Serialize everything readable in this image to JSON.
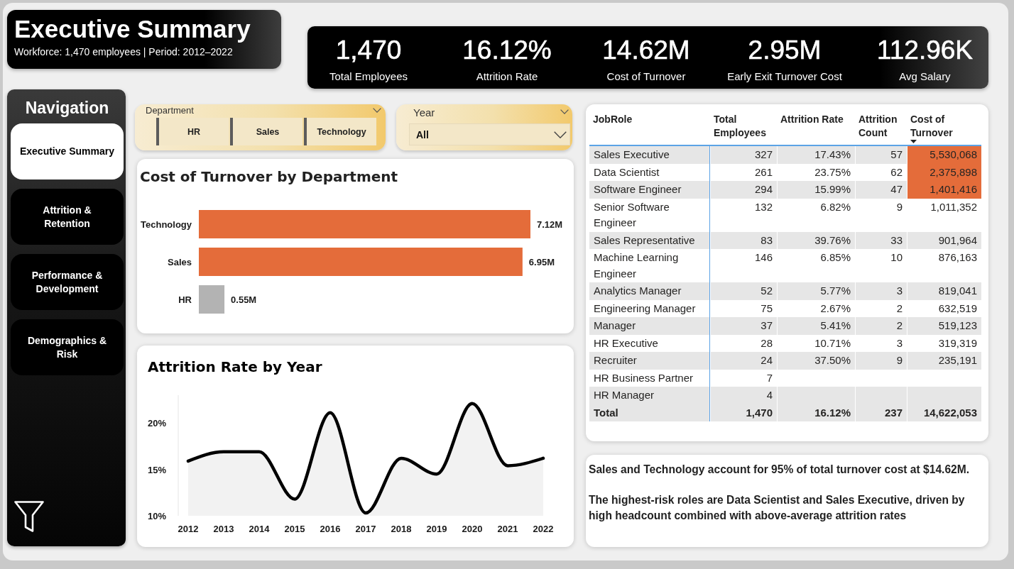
{
  "header": {
    "title": "Executive Summary",
    "subtitle": "Workforce: 1,470 employees | Period: 2012–2022"
  },
  "kpis": [
    {
      "value": "1,470",
      "label": "Total Employees"
    },
    {
      "value": "16.12%",
      "label": "Attrition Rate"
    },
    {
      "value": "14.62M",
      "label": "Cost of Turnover"
    },
    {
      "value": "2.95M",
      "label": "Early Exit Turnover Cost"
    },
    {
      "value": "112.96K",
      "label": "Avg Salary"
    }
  ],
  "navigation": {
    "title": "Navigation",
    "items": [
      {
        "label": "Executive Summary",
        "selected": true
      },
      {
        "label": "Attrition & Retention",
        "selected": false
      },
      {
        "label": "Performance & Development",
        "selected": false
      },
      {
        "label": "Demographics & Risk",
        "selected": false
      }
    ]
  },
  "department_slicer": {
    "title": "Department",
    "options": [
      {
        "label": "HR",
        "selected": false
      },
      {
        "label": "Sales",
        "selected": false
      },
      {
        "label": "Technology",
        "selected": false
      }
    ]
  },
  "year_slicer": {
    "title": "Year",
    "value": "All"
  },
  "cost_by_department": {
    "chart_data": {
      "type": "bar",
      "orientation": "horizontal",
      "title": "Cost of Turnover by Department",
      "categories": [
        "Technology",
        "Sales",
        "HR"
      ],
      "values": [
        7.12,
        6.95,
        0.55
      ],
      "colors": [
        "#e46c3a",
        "#e46c3a",
        "#b3b3b3"
      ],
      "value_labels": [
        "7.12M",
        "6.95M",
        "0.55M"
      ]
    }
  },
  "attrition_by_year": {
    "chart_data": {
      "type": "area",
      "title": "Attrition Rate by Year",
      "categories": [
        "2012",
        "2013",
        "2014",
        "2015",
        "2016",
        "2017",
        "2018",
        "2019",
        "2020",
        "2021",
        "2022"
      ],
      "values": [
        15.9,
        16.9,
        16.9,
        11.8,
        21.1,
        10.3,
        16.2,
        14.5,
        22.1,
        15.4,
        16.2
      ],
      "color": "#000000",
      "ylim": [
        10,
        23
      ],
      "yticks": [
        {
          "value": 10,
          "label": "10%"
        },
        {
          "value": 15,
          "label": "15%"
        },
        {
          "value": 20,
          "label": "20%"
        }
      ]
    }
  },
  "table": {
    "columns": [
      {
        "label": "JobRole",
        "sorted": false
      },
      {
        "label": "Total Employees",
        "sorted": false
      },
      {
        "label": "Attrition Rate",
        "sorted": false
      },
      {
        "label": "Attrition Count",
        "sorted": false
      },
      {
        "label": "Cost of Turnover",
        "sorted": true
      }
    ],
    "rows": [
      {
        "job_role": "Sales Executive",
        "total_employees": "327",
        "attrition_rate": "17.43%",
        "attrition_count": "57",
        "cost_of_turnover": "5,530,068",
        "highlighted": true
      },
      {
        "job_role": "Data Scientist",
        "total_employees": "261",
        "attrition_rate": "23.75%",
        "attrition_count": "62",
        "cost_of_turnover": "2,375,898",
        "highlighted": true
      },
      {
        "job_role": "Software Engineer",
        "total_employees": "294",
        "attrition_rate": "15.99%",
        "attrition_count": "47",
        "cost_of_turnover": "1,401,416",
        "highlighted": true
      },
      {
        "job_role": "Senior Software Engineer",
        "total_employees": "132",
        "attrition_rate": "6.82%",
        "attrition_count": "9",
        "cost_of_turnover": "1,011,352",
        "highlighted": false
      },
      {
        "job_role": "Sales Representative",
        "total_employees": "83",
        "attrition_rate": "39.76%",
        "attrition_count": "33",
        "cost_of_turnover": "901,964",
        "highlighted": false
      },
      {
        "job_role": "Machine Learning Engineer",
        "total_employees": "146",
        "attrition_rate": "6.85%",
        "attrition_count": "10",
        "cost_of_turnover": "876,163",
        "highlighted": false
      },
      {
        "job_role": "Analytics Manager",
        "total_employees": "52",
        "attrition_rate": "5.77%",
        "attrition_count": "3",
        "cost_of_turnover": "819,041",
        "highlighted": false
      },
      {
        "job_role": "Engineering Manager",
        "total_employees": "75",
        "attrition_rate": "2.67%",
        "attrition_count": "2",
        "cost_of_turnover": "632,519",
        "highlighted": false
      },
      {
        "job_role": "Manager",
        "total_employees": "37",
        "attrition_rate": "5.41%",
        "attrition_count": "2",
        "cost_of_turnover": "519,123",
        "highlighted": false
      },
      {
        "job_role": "HR Executive",
        "total_employees": "28",
        "attrition_rate": "10.71%",
        "attrition_count": "3",
        "cost_of_turnover": "319,319",
        "highlighted": false
      },
      {
        "job_role": "Recruiter",
        "total_employees": "24",
        "attrition_rate": "37.50%",
        "attrition_count": "9",
        "cost_of_turnover": "235,191",
        "highlighted": false
      },
      {
        "job_role": "HR Business Partner",
        "total_employees": "7",
        "highlighted": false
      },
      {
        "job_role": "HR Manager",
        "total_employees": "4",
        "highlighted": false
      }
    ],
    "total": {
      "label": "Total",
      "total_employees": "1,470",
      "attrition_rate": "16.12%",
      "attrition_count": "237",
      "cost_of_turnover": "14,622,053"
    }
  },
  "summary": {
    "paragraphs": [
      "Sales and Technology account for 95% of total turnover cost at $14.62M.",
      "The highest-risk roles are Data Scientist and Sales Executive, driven by high headcount combined with above-average attrition rates"
    ]
  }
}
